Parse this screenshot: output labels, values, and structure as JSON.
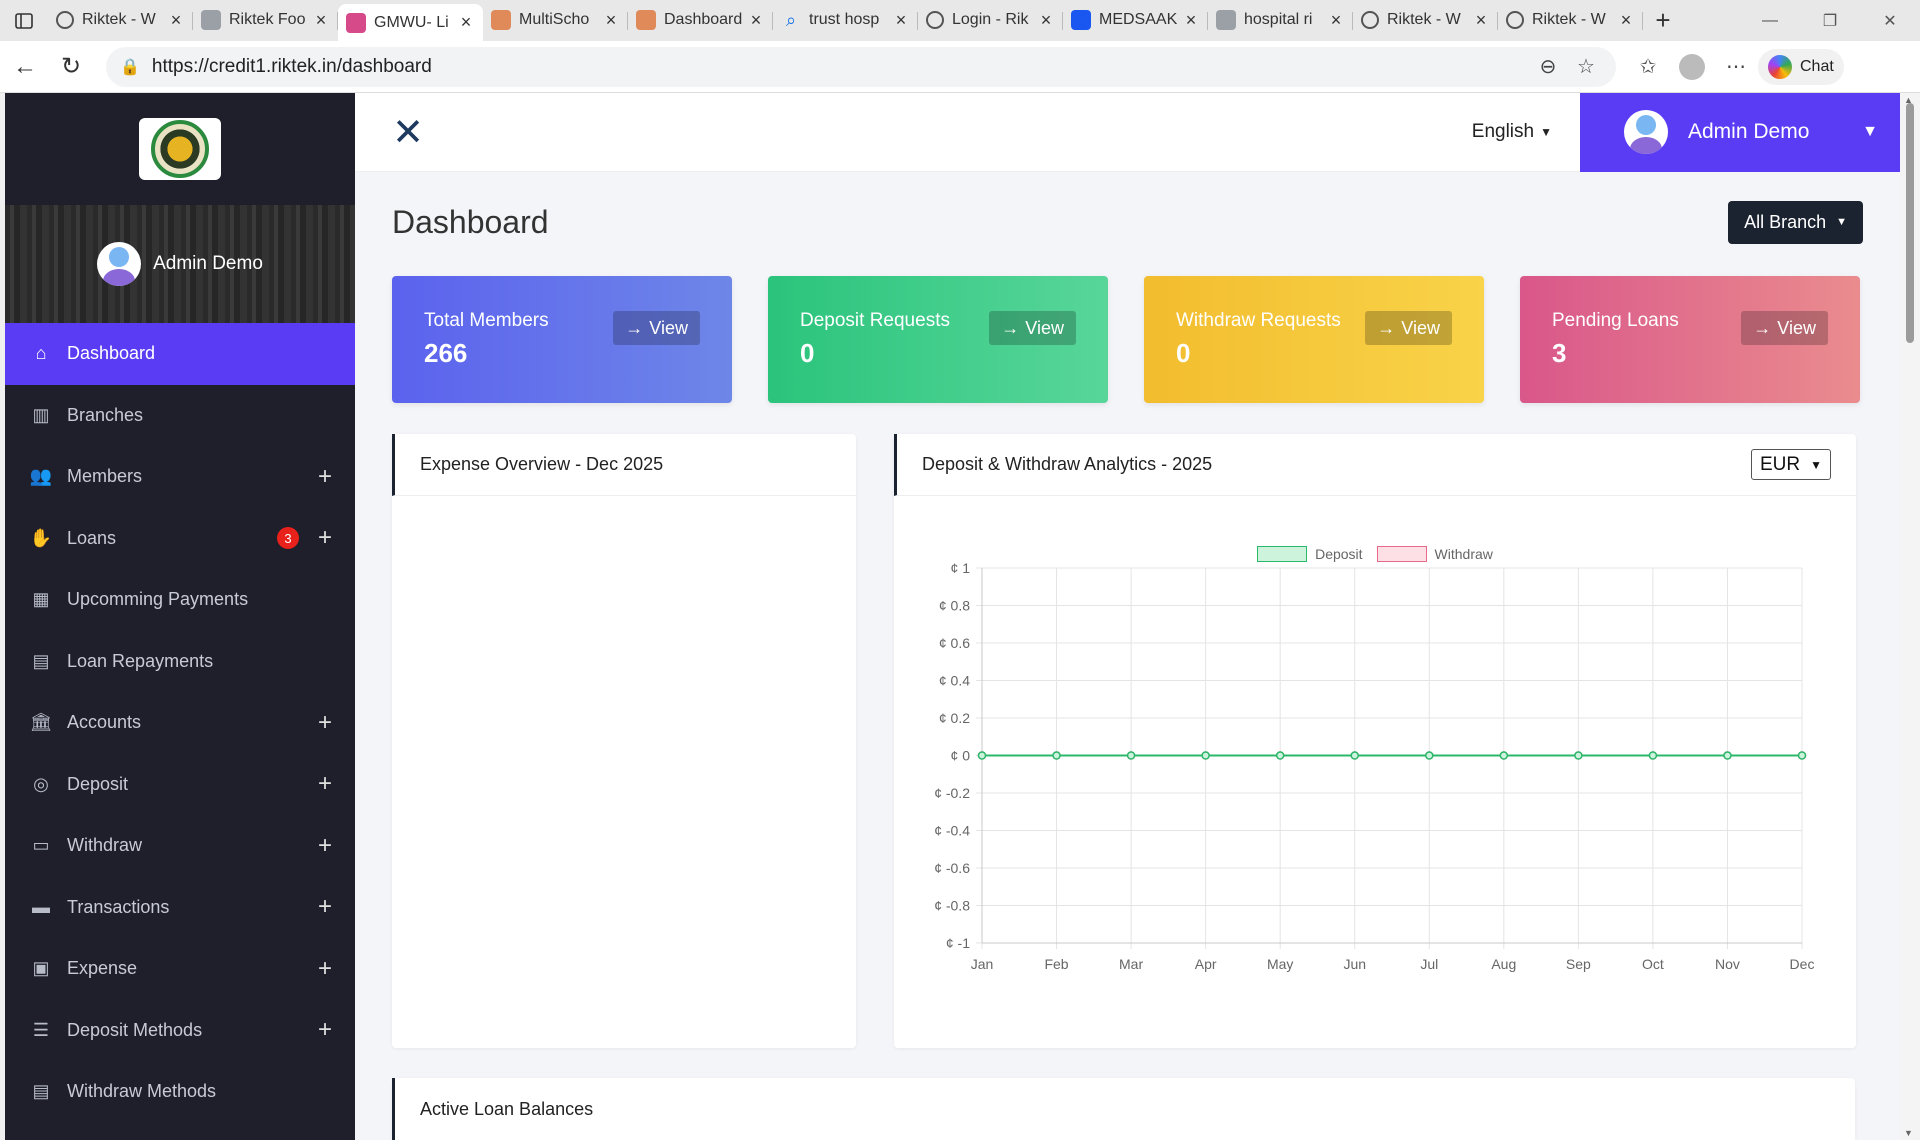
{
  "browser": {
    "tabs": [
      {
        "title": "Riktek - W",
        "icon": "globe-icon",
        "color": "#555555"
      },
      {
        "title": "Riktek Foo",
        "icon": "site-icon",
        "color": "#9aa0a6"
      },
      {
        "title": "GMWU- Li",
        "icon": "site-icon",
        "color": "#d64a8a",
        "active": true
      },
      {
        "title": "MultiScho",
        "icon": "site-icon",
        "color": "#e08a5a"
      },
      {
        "title": "Dashboard",
        "icon": "site-icon",
        "color": "#e08a5a"
      },
      {
        "title": "trust hosp",
        "icon": "search-icon",
        "color": "#1a73e8"
      },
      {
        "title": "Login - Rik",
        "icon": "globe-icon",
        "color": "#555555"
      },
      {
        "title": "MEDSAAK",
        "icon": "site-icon",
        "color": "#1a56f0"
      },
      {
        "title": "hospital ri",
        "icon": "site-icon",
        "color": "#9aa0a6"
      },
      {
        "title": "Riktek - W",
        "icon": "globe-icon",
        "color": "#555555"
      },
      {
        "title": "Riktek - W",
        "icon": "globe-icon",
        "color": "#555555"
      }
    ],
    "url": "https://credit1.riktek.in/dashboard",
    "chat_label": "Chat"
  },
  "sidebar": {
    "profile_name": "Admin Demo",
    "items": [
      {
        "label": "Dashboard",
        "icon": "dashboard-icon",
        "glyph": "⌂",
        "active": true
      },
      {
        "label": "Branches",
        "icon": "building-icon",
        "glyph": "▥"
      },
      {
        "label": "Members",
        "icon": "users-icon",
        "glyph": "👥",
        "expandable": true
      },
      {
        "label": "Loans",
        "icon": "hand-money-icon",
        "glyph": "✋",
        "expandable": true,
        "badge": "3"
      },
      {
        "label": "Upcomming Payments",
        "icon": "calendar-icon",
        "glyph": "▦"
      },
      {
        "label": "Loan Repayments",
        "icon": "receipt-icon",
        "glyph": "▤"
      },
      {
        "label": "Accounts",
        "icon": "bank-icon",
        "glyph": "🏛",
        "expandable": true
      },
      {
        "label": "Deposit",
        "icon": "coins-icon",
        "glyph": "◎",
        "expandable": true
      },
      {
        "label": "Withdraw",
        "icon": "card-icon",
        "glyph": "▭",
        "expandable": true
      },
      {
        "label": "Transactions",
        "icon": "wallet-icon",
        "glyph": "▬",
        "expandable": true
      },
      {
        "label": "Expense",
        "icon": "money-bill-icon",
        "glyph": "▣",
        "expandable": true
      },
      {
        "label": "Deposit Methods",
        "icon": "list-icon",
        "glyph": "☰",
        "expandable": true
      },
      {
        "label": "Withdraw Methods",
        "icon": "file-icon",
        "glyph": "▤"
      }
    ]
  },
  "header": {
    "language": "English",
    "user_name": "Admin Demo"
  },
  "page": {
    "title": "Dashboard",
    "branch_button": "All Branch"
  },
  "cards": [
    {
      "label": "Total Members",
      "value": "266",
      "button": "View",
      "style": "c-blue"
    },
    {
      "label": "Deposit Requests",
      "value": "0",
      "button": "View",
      "style": "c-green"
    },
    {
      "label": "Withdraw Requests",
      "value": "0",
      "button": "View",
      "style": "c-yellow"
    },
    {
      "label": "Pending Loans",
      "value": "3",
      "button": "View",
      "style": "c-pink"
    }
  ],
  "expense_panel": {
    "title": "Expense Overview - Dec 2025"
  },
  "analytics_panel": {
    "title": "Deposit & Withdraw Analytics - 2025",
    "currency": "EUR"
  },
  "loans_panel": {
    "title": "Active Loan Balances"
  },
  "chart_data": {
    "type": "line",
    "categories": [
      "Jan",
      "Feb",
      "Mar",
      "Apr",
      "May",
      "Jun",
      "Jul",
      "Aug",
      "Sep",
      "Oct",
      "Nov",
      "Dec"
    ],
    "series": [
      {
        "name": "Deposit",
        "values": [
          0,
          0,
          0,
          0,
          0,
          0,
          0,
          0,
          0,
          0,
          0,
          0
        ],
        "color": "#2bb86b",
        "fill": "#cdf3dd"
      },
      {
        "name": "Withdraw",
        "values": [
          0,
          0,
          0,
          0,
          0,
          0,
          0,
          0,
          0,
          0,
          0,
          0
        ],
        "color": "#e86a8a",
        "fill": "#fde0e6"
      }
    ],
    "yticks": [
      "¢ 1",
      "¢ 0.8",
      "¢ 0.6",
      "¢ 0.4",
      "¢ 0.2",
      "¢ 0",
      "¢ -0.2",
      "¢ -0.4",
      "¢ -0.6",
      "¢ -0.8",
      "¢ -1"
    ],
    "ylim": [
      -1,
      1
    ],
    "legend": "top-center",
    "grid": true
  }
}
